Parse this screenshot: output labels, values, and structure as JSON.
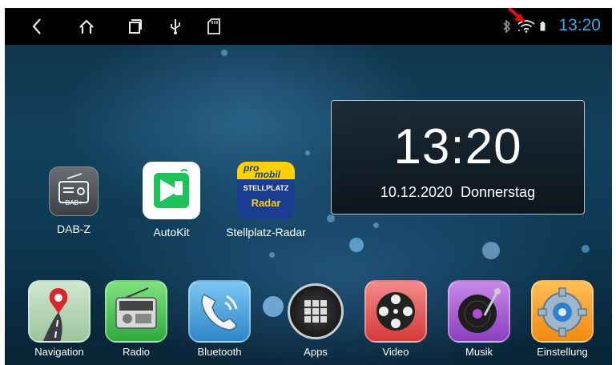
{
  "status_bar": {
    "clock": "13:20",
    "icons": [
      "back-icon",
      "home-icon",
      "recent-apps-icon",
      "usb-icon",
      "sd-card-icon",
      "bluetooth-icon",
      "wifi-icon",
      "battery-icon"
    ]
  },
  "desktop_apps": [
    {
      "label": "DAB-Z",
      "badge": "DAB+"
    },
    {
      "label": "AutoKit"
    },
    {
      "label": "Stellplatz-Radar",
      "logo_line1": "pro",
      "logo_line2": "mobil",
      "logo_line3": "STELLPLATZ",
      "logo_line4": "Radar"
    }
  ],
  "clock_widget": {
    "time": "13:20",
    "date": "10.12.2020",
    "weekday": "Donnerstag"
  },
  "dock": [
    {
      "label": "Navigation"
    },
    {
      "label": "Radio"
    },
    {
      "label": "Bluetooth"
    },
    {
      "label": "Apps"
    },
    {
      "label": "Video"
    },
    {
      "label": "Musik"
    },
    {
      "label": "Einstellung"
    }
  ],
  "colors": {
    "clock_accent": "#35a8e8",
    "annotation_arrow": "#e01010"
  }
}
